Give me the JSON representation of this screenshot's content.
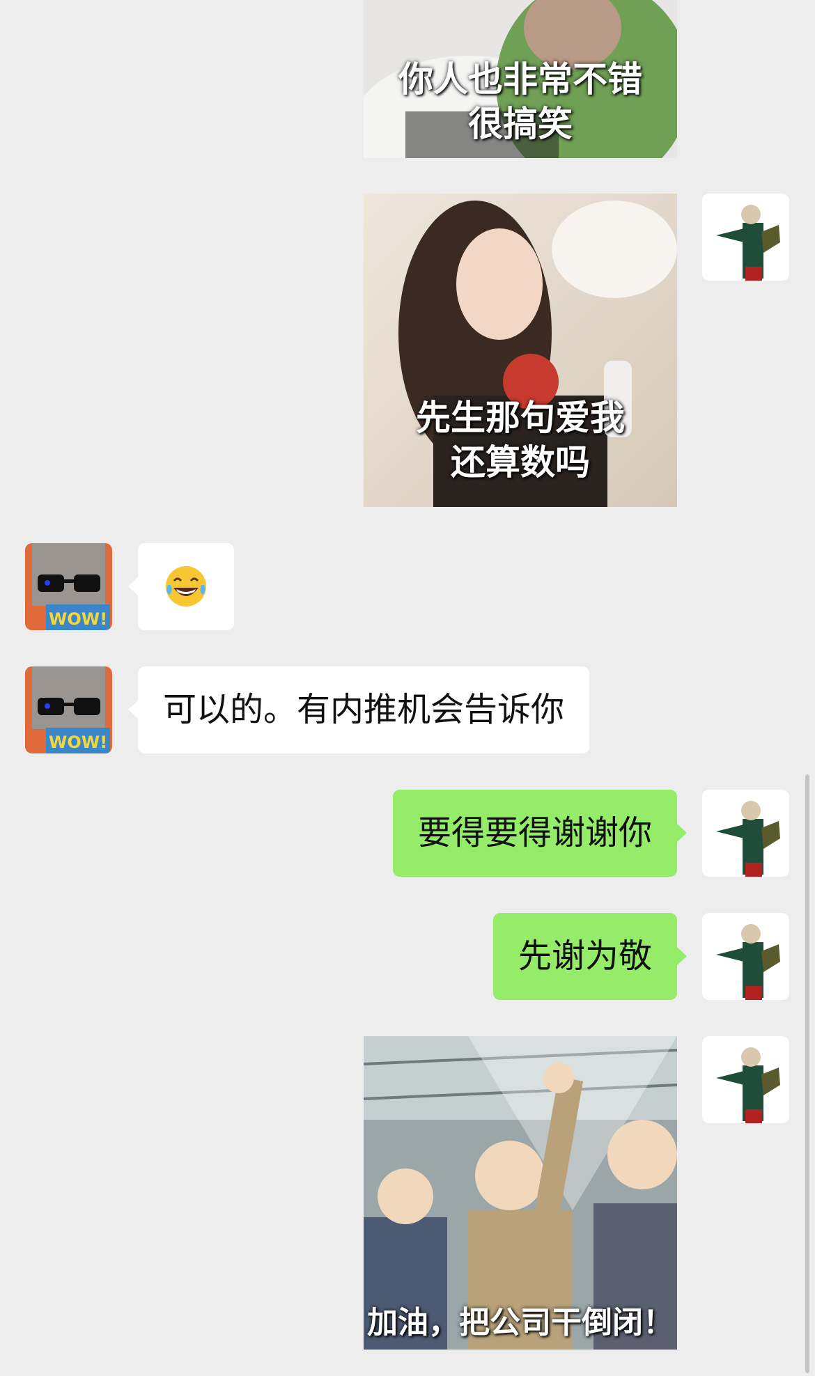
{
  "messages": [
    {
      "id": "m1",
      "side": "out",
      "type": "sticker",
      "caption": "你人也非常不错\n很搞笑"
    },
    {
      "id": "m2",
      "side": "out",
      "type": "sticker",
      "caption": "先生那句爱我\n还算数吗"
    },
    {
      "id": "m3",
      "side": "in",
      "type": "emoji",
      "emoji_name": "joy-tears-emoji"
    },
    {
      "id": "m4",
      "side": "in",
      "type": "text",
      "text": "可以的。有内推机会告诉你"
    },
    {
      "id": "m5",
      "side": "out",
      "type": "text",
      "text": "要得要得谢谢你"
    },
    {
      "id": "m6",
      "side": "out",
      "type": "text",
      "text": "先谢为敬"
    },
    {
      "id": "m7",
      "side": "out",
      "type": "sticker",
      "caption": "加油，把公司干倒闭！"
    }
  ],
  "avatars": {
    "contact": {
      "icon": "cat-sunglasses-avatar",
      "badge_text": "WOW!"
    },
    "self": {
      "icon": "anime-character-avatar"
    }
  },
  "colors": {
    "background": "#ededed",
    "bubble_in": "#ffffff",
    "bubble_out": "#95ec69",
    "text": "#111111"
  }
}
